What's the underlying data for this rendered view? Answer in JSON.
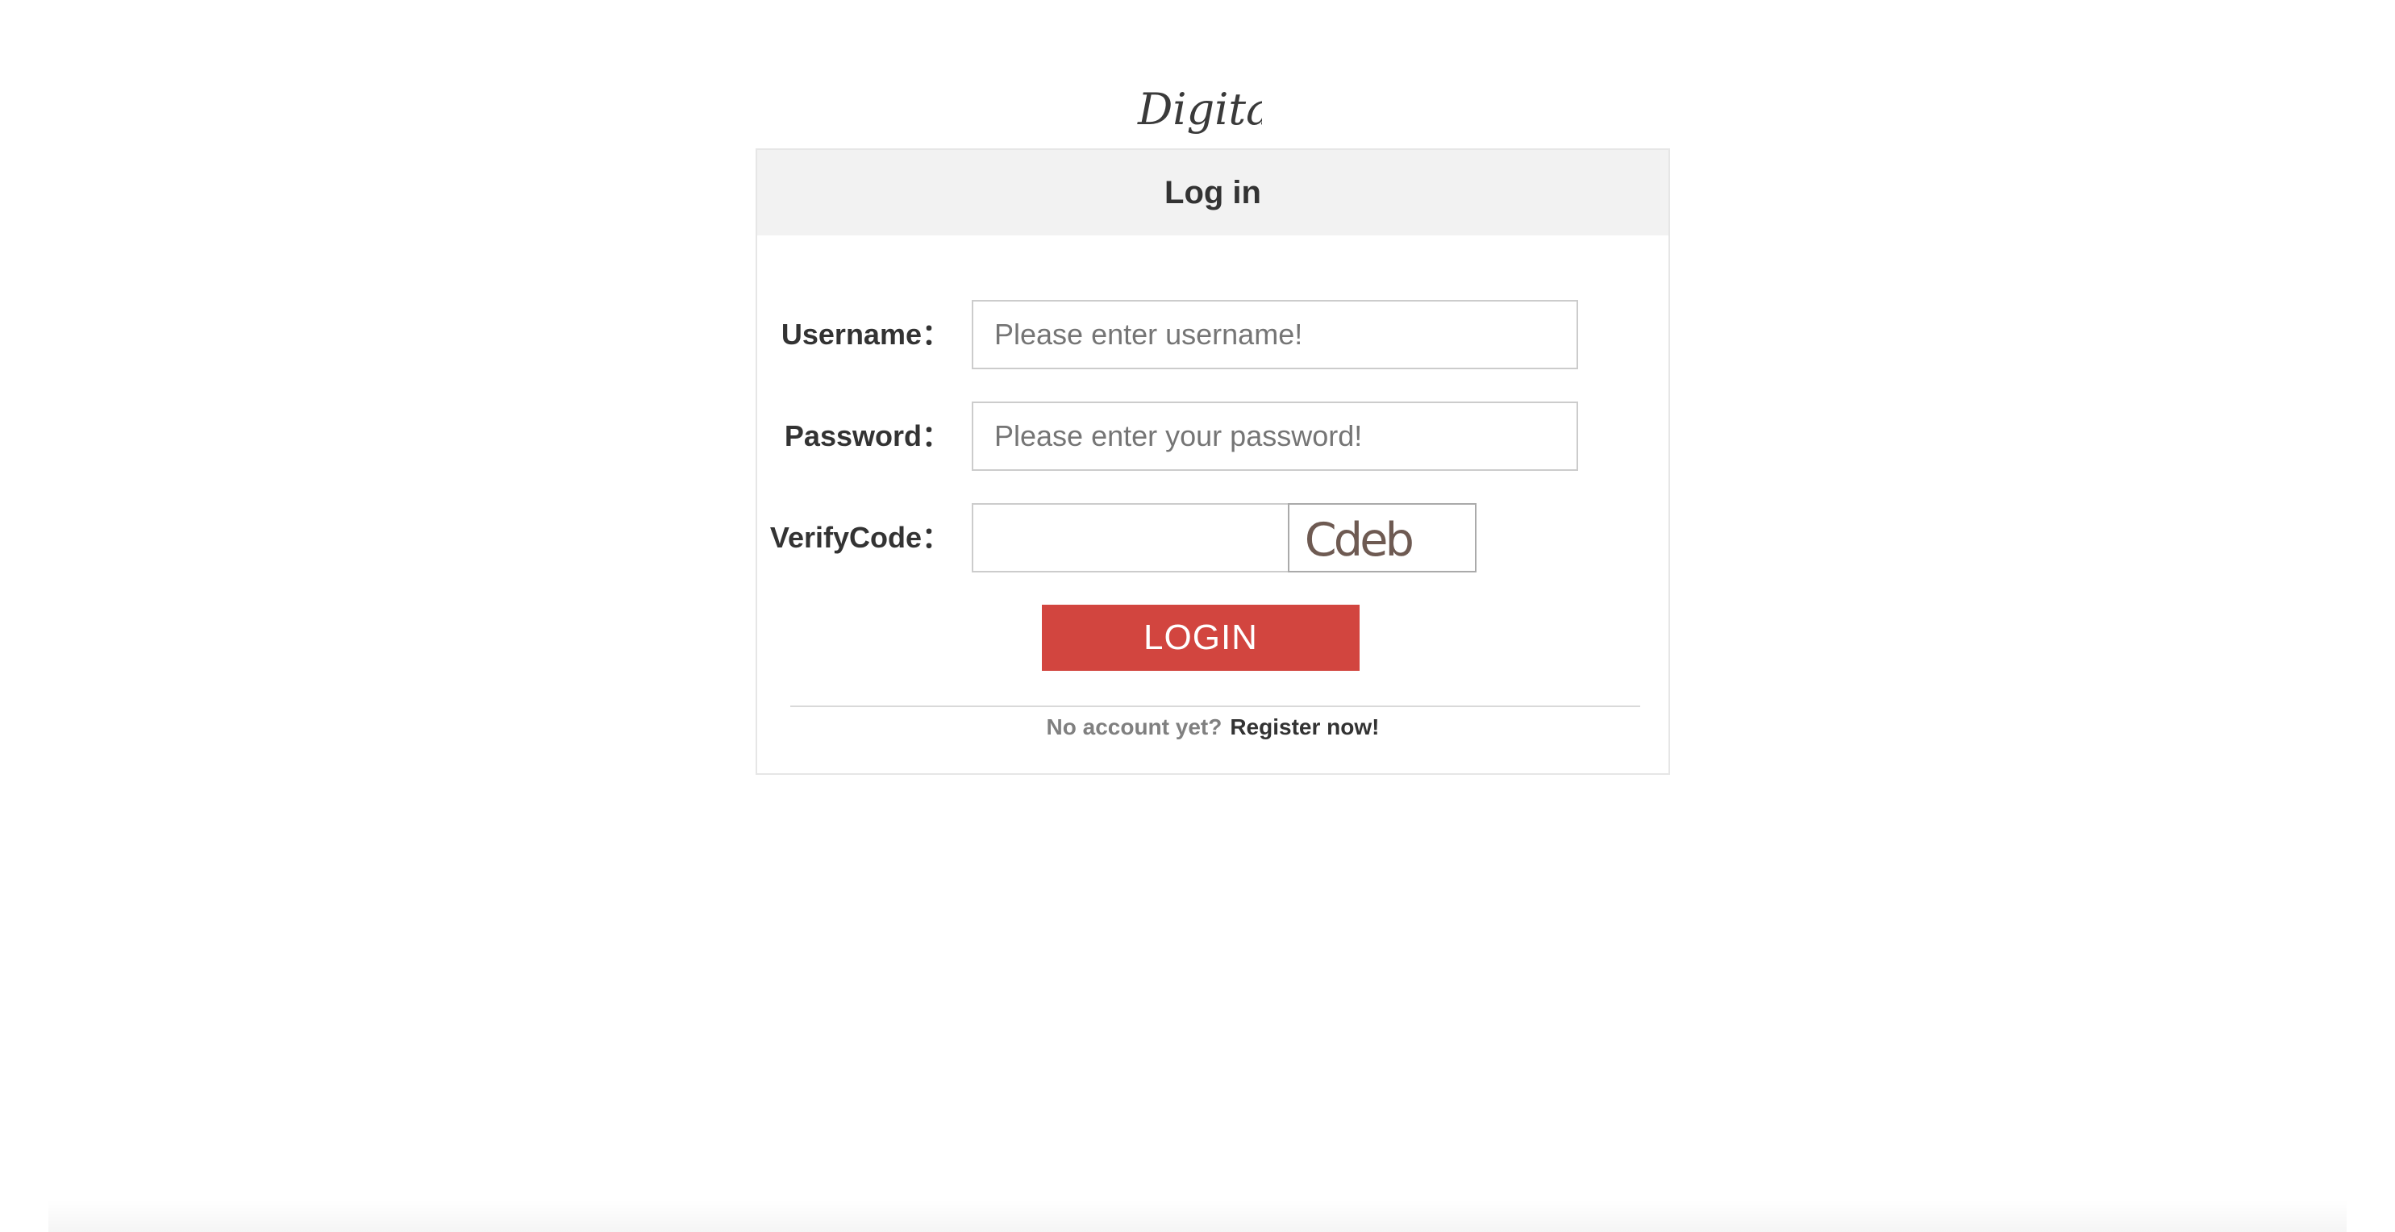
{
  "logo": {
    "text": "Digital"
  },
  "login_panel": {
    "title": "Log in",
    "username": {
      "label": "Username：",
      "placeholder": "Please enter username!",
      "value": ""
    },
    "password": {
      "label": "Password：",
      "placeholder": "Please enter your password!",
      "value": ""
    },
    "verify_code": {
      "label": "VerifyCode：",
      "value": "",
      "captcha_text": "Cdeb"
    },
    "login_button": "LOGIN",
    "register_prompt": "No account yet?",
    "register_link": "Register now!"
  },
  "colors": {
    "accent": "#d2453f",
    "header_bg": "#f2f2f2",
    "border": "#e6e6e6"
  }
}
